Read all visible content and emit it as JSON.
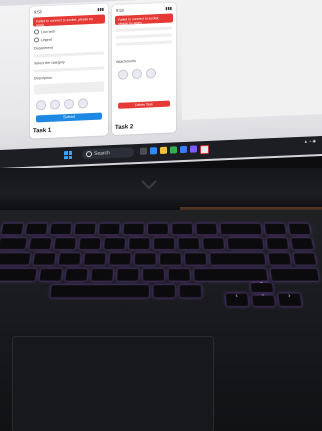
{
  "screen": {
    "phone_a": {
      "time": "9:53",
      "alert": "Failed to connect to socket, please try again",
      "options": [
        "Low tech",
        "Urgent"
      ],
      "label_department": "Department",
      "label_category": "Select the category",
      "label_description": "Description",
      "submit_label": "Submit",
      "task_label": "Task 1"
    },
    "phone_b": {
      "time": "9:53",
      "alert": "Failed to connect to socket, please try again",
      "label_attachments": "Attachments",
      "red_button_label": "Delete Task",
      "task_label": "Task 2"
    }
  },
  "taskbar": {
    "search_placeholder": "Search"
  }
}
